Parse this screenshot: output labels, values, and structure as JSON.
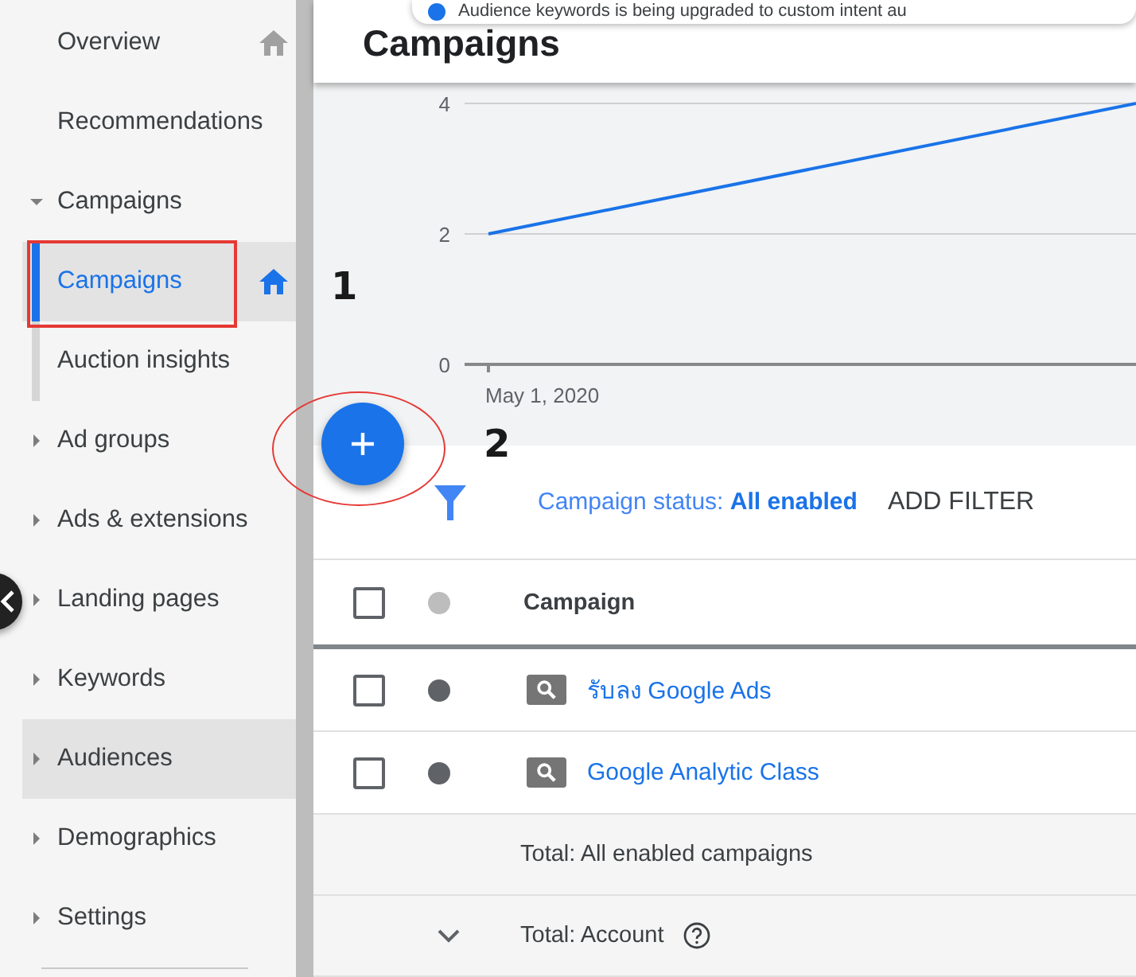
{
  "sidebar": {
    "items": [
      {
        "label": "Overview",
        "selected": false,
        "home_icon": true,
        "highlighted": false
      },
      {
        "label": "Recommendations",
        "selected": false,
        "highlighted": false
      },
      {
        "label": "Campaigns",
        "selected": false,
        "expanded": true,
        "highlighted": false,
        "children": [
          {
            "label": "Campaigns",
            "selected": true,
            "home_icon": true,
            "highlighted": false
          },
          {
            "label": "Auction insights",
            "selected": false,
            "highlighted": false
          }
        ]
      },
      {
        "label": "Ad groups",
        "selected": false,
        "expanded": false,
        "highlighted": false
      },
      {
        "label": "Ads & extensions",
        "selected": false,
        "expanded": false,
        "highlighted": false
      },
      {
        "label": "Landing pages",
        "selected": false,
        "expanded": false,
        "highlighted": false
      },
      {
        "label": "Keywords",
        "selected": false,
        "expanded": false,
        "highlighted": false
      },
      {
        "label": "Audiences",
        "selected": false,
        "expanded": false,
        "highlighted": true
      },
      {
        "label": "Demographics",
        "selected": false,
        "expanded": false,
        "highlighted": false
      },
      {
        "label": "Settings",
        "selected": false,
        "expanded": false,
        "highlighted": false
      }
    ]
  },
  "banner": {
    "text": "Audience keywords is being upgraded to custom intent au"
  },
  "header": {
    "title": "Campaigns"
  },
  "chart": {
    "y_axis_labels": [
      "4",
      "2",
      "0"
    ],
    "x_axis_label": "May 1, 2020"
  },
  "filter": {
    "text": "Campaign status: **All enabled**",
    "add_filter": "ADD FILTER"
  },
  "table": {
    "header": {
      "checked": false,
      "color": "#bdbdbd",
      "column": "Campaign"
    },
    "rows": [
      {
        "checked": false,
        "color": "#5f6368",
        "name": "รับลง Google Ads"
      },
      {
        "checked": false,
        "color": "#5f6368",
        "name": "Google Analytic Class"
      }
    ],
    "totals": [
      {
        "label": "Total: All enabled campaigns",
        "expandable": false,
        "help": false
      },
      {
        "label": "Total: Account",
        "expandable": true,
        "help": true
      }
    ]
  },
  "annotations": [
    {
      "kind": "box"
    },
    {
      "kind": "ring"
    },
    {
      "kind": "number",
      "text": "1"
    },
    {
      "kind": "number",
      "text": "2"
    }
  ]
}
